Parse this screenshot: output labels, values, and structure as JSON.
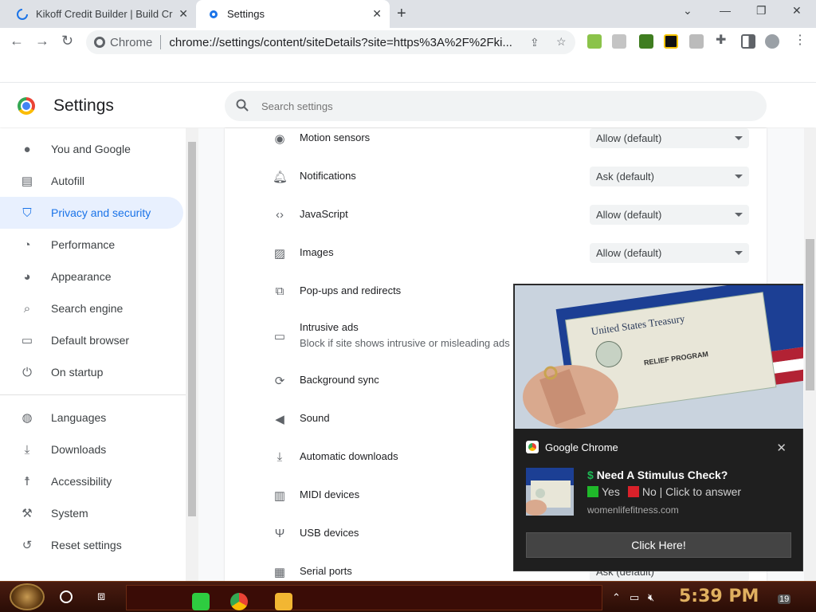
{
  "tabs": [
    {
      "title": "Kikoff Credit Builder | Build Cr",
      "icon": "loading-spinner-icon"
    },
    {
      "title": "Settings",
      "icon": "gear-icon"
    }
  ],
  "toolbar": {
    "site_chip": "Chrome",
    "url": "chrome://settings/content/siteDetails?site=https%3A%2F%2Fki..."
  },
  "header": {
    "title": "Settings",
    "search_placeholder": "Search settings"
  },
  "sidebar": {
    "items": [
      {
        "label": "You and Google",
        "icon": "person-icon"
      },
      {
        "label": "Autofill",
        "icon": "clipboard-icon"
      },
      {
        "label": "Privacy and security",
        "icon": "shield-icon",
        "active": true
      },
      {
        "label": "Performance",
        "icon": "speedometer-icon"
      },
      {
        "label": "Appearance",
        "icon": "palette-icon"
      },
      {
        "label": "Search engine",
        "icon": "search-icon"
      },
      {
        "label": "Default browser",
        "icon": "browser-window-icon"
      },
      {
        "label": "On startup",
        "icon": "power-icon"
      },
      {
        "label": "Languages",
        "icon": "globe-icon"
      },
      {
        "label": "Downloads",
        "icon": "download-icon"
      },
      {
        "label": "Accessibility",
        "icon": "accessibility-icon"
      },
      {
        "label": "System",
        "icon": "wrench-icon"
      },
      {
        "label": "Reset settings",
        "icon": "history-icon"
      }
    ]
  },
  "permissions": [
    {
      "label": "Motion sensors",
      "value": "Allow (default)"
    },
    {
      "label": "Notifications",
      "value": "Ask (default)"
    },
    {
      "label": "JavaScript",
      "value": "Allow (default)"
    },
    {
      "label": "Images",
      "value": "Allow (default)"
    },
    {
      "label": "Pop-ups and redirects",
      "value": ""
    },
    {
      "label": "Intrusive ads",
      "sub": "Block if site shows intrusive or misleading ads",
      "value": ""
    },
    {
      "label": "Background sync",
      "value": ""
    },
    {
      "label": "Sound",
      "value": ""
    },
    {
      "label": "Automatic downloads",
      "value": ""
    },
    {
      "label": "MIDI devices",
      "value": ""
    },
    {
      "label": "USB devices",
      "value": ""
    },
    {
      "label": "Serial ports",
      "value": "Ask (default)"
    }
  ],
  "notification": {
    "app": "Google Chrome",
    "title": "Need A Stimulus Check?",
    "title_prefix": "$",
    "yes": "Yes",
    "no_text": "No | Click to answer",
    "site": "womenlifefitness.com",
    "button": "Click Here!",
    "image_text": {
      "brand": "United States Treasury",
      "program": "RELIEF PROGRAM"
    },
    "colors": {
      "yes": "#1fb82a",
      "no": "#d9212a"
    }
  },
  "taskbar": {
    "time": "5:39 PM",
    "notification_count": "19"
  },
  "colors": {
    "accent": "#1a73e8",
    "active_bg": "#e8f0fe"
  }
}
